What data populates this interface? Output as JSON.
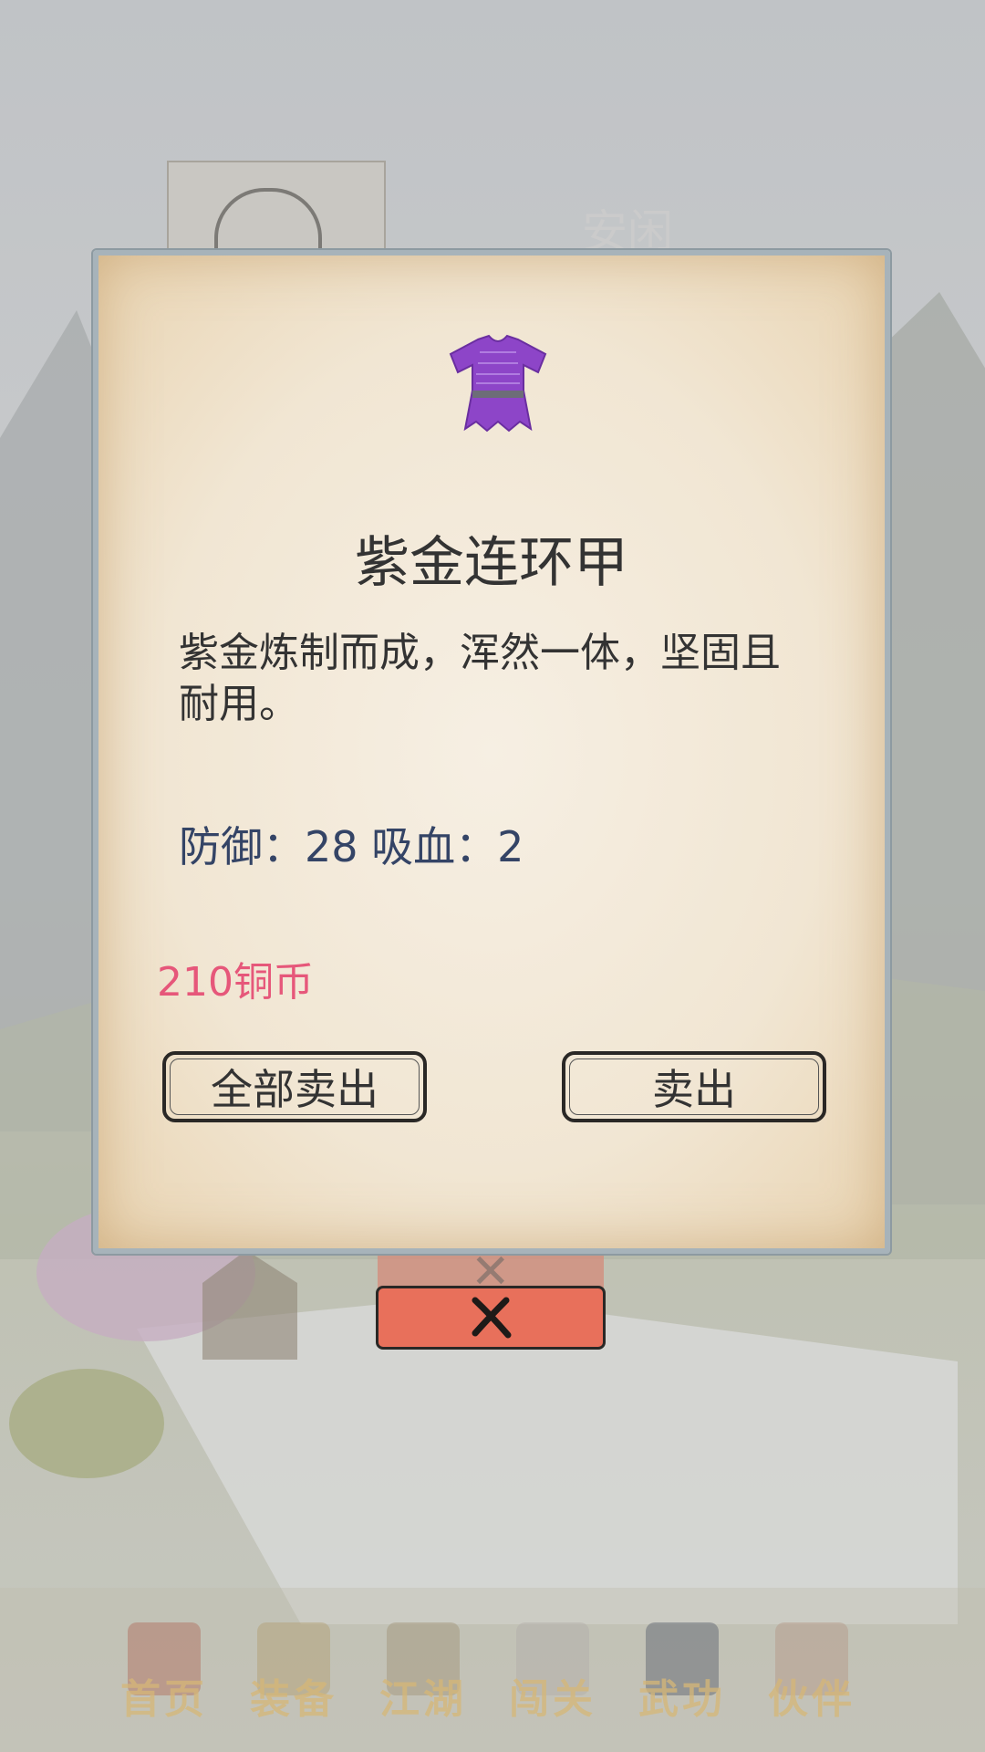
{
  "background": {
    "character_name": "安闲"
  },
  "dialog": {
    "icon": "purple-armor-icon",
    "item_name": "紫金连环甲",
    "description": "紫金炼制而成，浑然一体，坚固且耐用。",
    "stats": "防御：28 吸血：2",
    "price": "210铜币",
    "sell_all_label": "全部卖出",
    "sell_label": "卖出"
  },
  "close_icon": "close-x-icon",
  "nav": {
    "items": [
      {
        "label": "首页",
        "icon": "home-icon"
      },
      {
        "label": "装备",
        "icon": "equipment-icon"
      },
      {
        "label": "江湖",
        "icon": "scroll-icon"
      },
      {
        "label": "闯关",
        "icon": "crossed-swords-icon"
      },
      {
        "label": "武功",
        "icon": "book-icon"
      },
      {
        "label": "伙伴",
        "icon": "partners-icon"
      }
    ]
  },
  "colors": {
    "price": "#e6577a",
    "stats": "#344466",
    "close_button": "#e8705b",
    "armor": "#8d45c8",
    "nav_label": "#d6b777"
  }
}
